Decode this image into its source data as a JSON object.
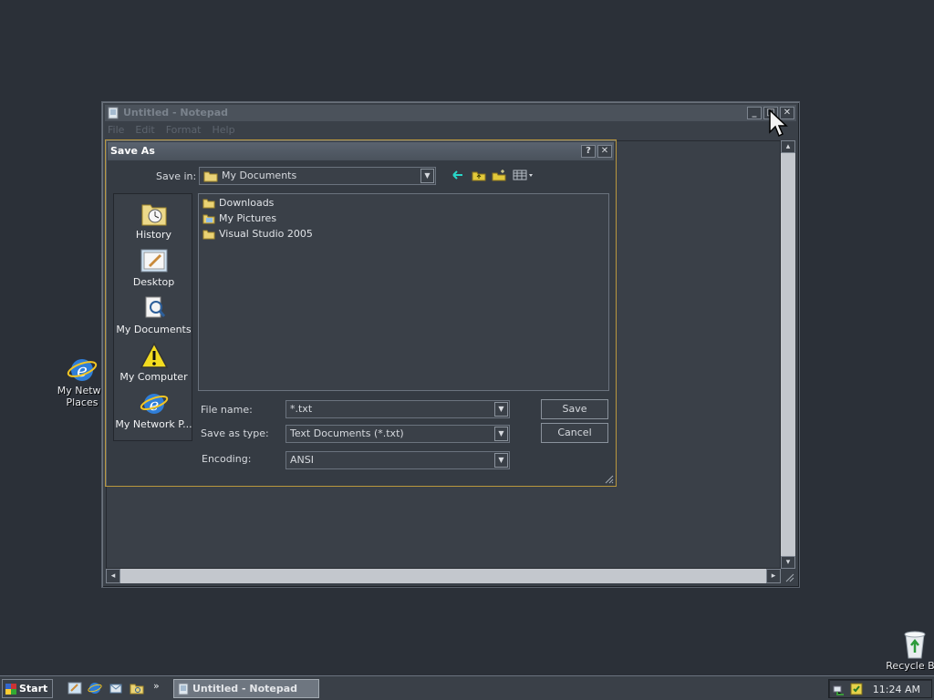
{
  "desktop": {
    "icons": [
      {
        "label_line1": "My Netwo",
        "label_line2": "Places",
        "icon": "internet-explorer-icon"
      },
      {
        "label": "Recycle Bin",
        "icon": "recycle-bin-icon"
      }
    ]
  },
  "notepad": {
    "title": "Untitled - Notepad",
    "menu": [
      "File",
      "Edit",
      "Format",
      "Help"
    ],
    "buttons": {
      "minimize": "_",
      "maximize": "□",
      "close": "✕"
    }
  },
  "dialog": {
    "title": "Save As",
    "help": "?",
    "close": "✕",
    "save_in_label": "Save in:",
    "save_in_value": "My Documents",
    "places": [
      "History",
      "Desktop",
      "My Documents",
      "My Computer",
      "My Network P..."
    ],
    "files": [
      "Downloads",
      "My Pictures",
      "Visual Studio 2005"
    ],
    "file_name_label": "File name:",
    "file_name_value": "*.txt",
    "save_as_type_label": "Save as type:",
    "save_as_type_value": "Text Documents (*.txt)",
    "encoding_label": "Encoding:",
    "encoding_value": "ANSI",
    "save_button": "Save",
    "cancel_button": "Cancel"
  },
  "taskbar": {
    "start": "Start",
    "task": "Untitled - Notepad",
    "clock": "11:24 AM",
    "chevron": "»"
  },
  "colors": {
    "accent_border": "#b9973e",
    "desktop": "#2b3038"
  }
}
